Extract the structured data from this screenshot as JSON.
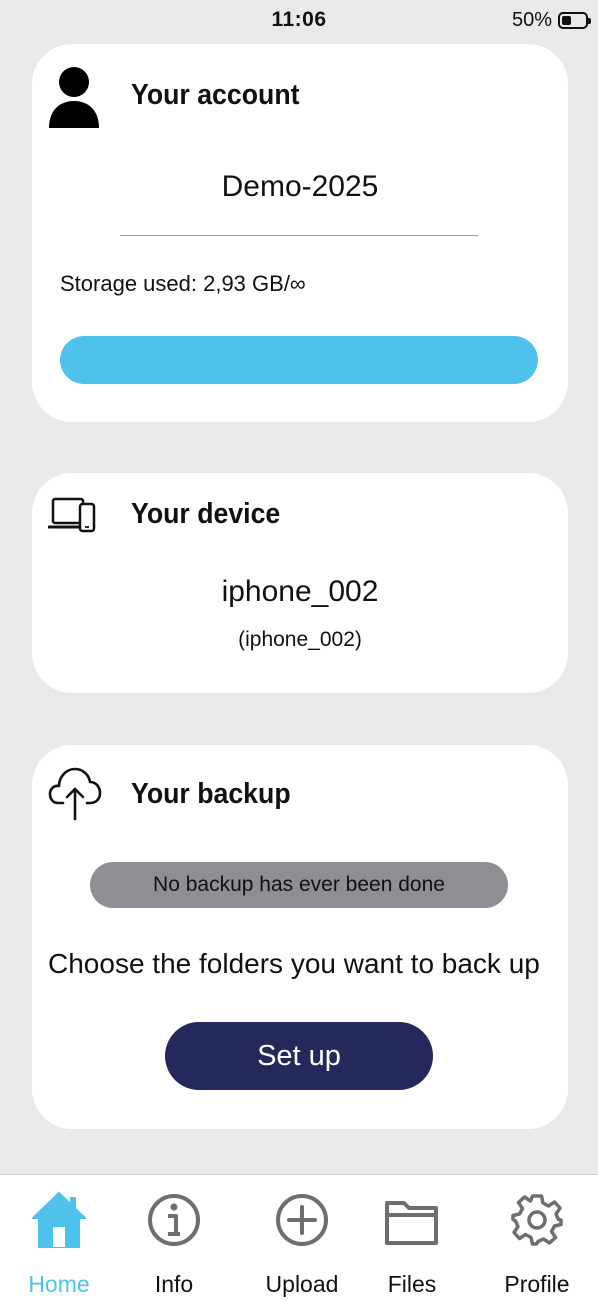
{
  "status_bar": {
    "time": "11:06",
    "battery": "50%",
    "battery_level": 0.5
  },
  "account": {
    "title": "Your account",
    "icon": "person-icon",
    "name": "Demo-2025",
    "storage_label": "Storage used: 2,93 GB/∞",
    "storage_fraction": 1.0
  },
  "device": {
    "title": "Your device",
    "icon": "devices-icon",
    "name": "iphone_002",
    "subtitle": "(iphone_002)"
  },
  "backup": {
    "title": "Your backup",
    "icon": "cloud-upload-icon",
    "status": "No backup has ever been done",
    "hint": "Choose the folders you want to back up",
    "setup_label": "Set up"
  },
  "tab_bar": {
    "tabs": [
      {
        "label": "Home",
        "icon": "home-icon",
        "active": true
      },
      {
        "label": "Info",
        "icon": "info-icon",
        "active": false
      },
      {
        "label": "Upload",
        "icon": "plus-circle-icon",
        "active": false
      },
      {
        "label": "Files",
        "icon": "folder-icon",
        "active": false
      },
      {
        "label": "Profile",
        "icon": "gear-icon",
        "active": false
      }
    ]
  },
  "colors": {
    "accent": "#4ec1ec",
    "primary_button": "#24285a",
    "status_pill": "#8e8e93",
    "background": "#e9e9e9"
  }
}
